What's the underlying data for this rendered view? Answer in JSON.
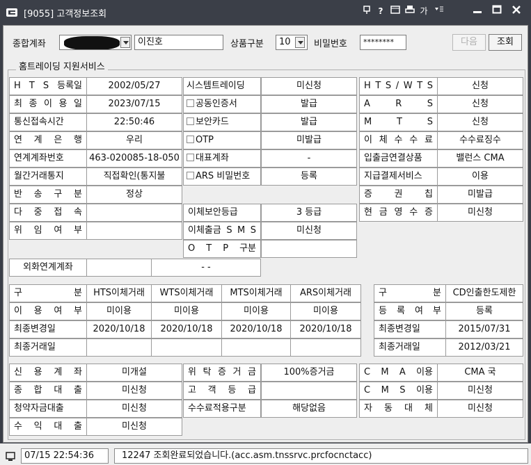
{
  "window": {
    "title": "[9055] 고객정보조회",
    "controls": [
      "?",
      "가"
    ]
  },
  "toolbar": {
    "account_label": "종합계좌",
    "account_name": "이진호",
    "product_label": "상품구분",
    "product_value": "10",
    "password_label": "비밀번호",
    "password_value": "********",
    "next_label": "다음",
    "query_label": "조회"
  },
  "section_title": "홈트레이딩 지원서비스",
  "left_rows": [
    {
      "label": "H T S 등록일",
      "value": "2002/05/27"
    },
    {
      "label": "최 종 이 용 일",
      "value": "2023/07/15"
    },
    {
      "label": "통신접속시간",
      "value": "22:50:46"
    },
    {
      "label": "연 계 은 행",
      "value": "우리"
    },
    {
      "label": "연계계좌번호",
      "value": "463-020085-18-050"
    },
    {
      "label": "월간거래통지",
      "value": "직접확인(통지불"
    },
    {
      "label": "반 송 구 분",
      "value": "정상"
    },
    {
      "label": "다 중 접 속",
      "value": ""
    },
    {
      "label": "위 임 여 부",
      "value": ""
    }
  ],
  "mid_rows": [
    {
      "label": "시스템트레이딩",
      "value": "미신청",
      "checkbox": false
    },
    {
      "label": "공동인증서",
      "value": "발급",
      "checkbox": true
    },
    {
      "label": "보안카드",
      "value": "발급",
      "checkbox": true
    },
    {
      "label": "OTP",
      "value": "미발급",
      "checkbox": true
    },
    {
      "label": "대표계좌",
      "value": "-",
      "checkbox": true
    },
    {
      "label": "ARS 비밀번호",
      "value": "등록",
      "checkbox": true
    }
  ],
  "mid_rows2": [
    {
      "label": "이체보안등급",
      "value": "3 등급"
    },
    {
      "label": "이체출금 S M S",
      "value": "미신청"
    },
    {
      "label": "O T P 구분",
      "value": ""
    }
  ],
  "right_rows": [
    {
      "label": "H T S / W T S",
      "value": "신청"
    },
    {
      "label": "A R S",
      "value": "신청"
    },
    {
      "label": "M T S",
      "value": "신청"
    },
    {
      "label": "이 체 수 수 료",
      "value": "수수료징수"
    },
    {
      "label": "입출금연결상품",
      "value": "밸런스 CMA"
    },
    {
      "label": "지급결제서비스",
      "value": "이용"
    },
    {
      "label": "증 권 칩",
      "value": "미발급"
    },
    {
      "label": "현 금 영 수 증",
      "value": "미신청"
    }
  ],
  "foreign": {
    "label": "외화연계계좌",
    "value1": "",
    "value2": "-   -"
  },
  "transfer_table": {
    "headers": [
      "구 분",
      "HTS이체거래",
      "WTS이체거래",
      "MTS이체거래",
      "ARS이체거래"
    ],
    "rows": [
      {
        "label": "이 용 여 부",
        "cells": [
          "미이용",
          "미이용",
          "미이용",
          "미이용"
        ]
      },
      {
        "label": "최종변경일",
        "cells": [
          "2020/10/18",
          "2020/10/18",
          "2020/10/18",
          "2020/10/18"
        ]
      },
      {
        "label": "최종거래일",
        "cells": [
          "",
          "",
          "",
          ""
        ]
      }
    ]
  },
  "cd_table": {
    "headers": [
      "구 분",
      "CD인출한도제한"
    ],
    "rows": [
      {
        "label": "등 록 여 부",
        "value": "등록"
      },
      {
        "label": "최종변경일",
        "value": "2015/07/31"
      },
      {
        "label": "최종거래일",
        "value": "2012/03/21"
      }
    ]
  },
  "bottom_left": [
    {
      "label": "신 용 계 좌",
      "value": "미개설"
    },
    {
      "label": "종 합 대 출",
      "value": "미신청"
    },
    {
      "label": "청약자금대출",
      "value": "미신청"
    },
    {
      "label": "수 익 대 출",
      "value": "미신청"
    }
  ],
  "bottom_mid": [
    {
      "label": "위 탁 증 거 금",
      "value": "100%증거금"
    },
    {
      "label": "고 객 등 급",
      "value": ""
    },
    {
      "label": "수수료적용구분",
      "value": "해당없음"
    }
  ],
  "bottom_right": [
    {
      "label": "C M A 이용",
      "value": "CMA 국"
    },
    {
      "label": "C M S 이용",
      "value": "미신청"
    },
    {
      "label": "자 동 대 체",
      "value": "미신청"
    }
  ],
  "status": {
    "time": "07/15 22:54:36",
    "message": "12247 조회완료되었습니다.(acc.asm.tnssrvc.prcfocnctacc)"
  }
}
